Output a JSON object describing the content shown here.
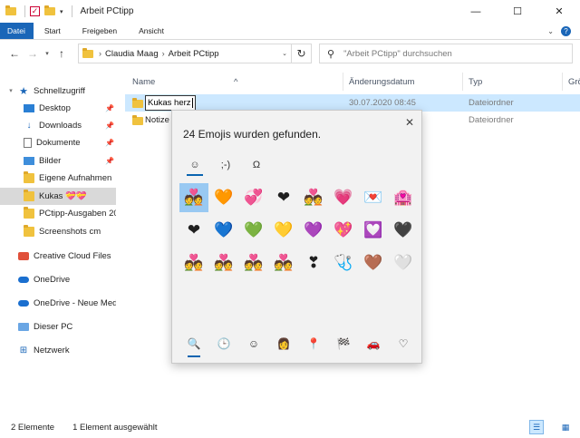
{
  "window": {
    "title": "Arbeit PCtipp",
    "minimize": "—",
    "maximize": "☐",
    "close": "✕"
  },
  "ribbon": {
    "tabs": [
      "Datei",
      "Start",
      "Freigeben",
      "Ansicht"
    ],
    "help": "?"
  },
  "address": {
    "crumbs": [
      "Claudia Maag",
      "Arbeit PCtipp"
    ],
    "search_placeholder": "\"Arbeit PCtipp\" durchsuchen"
  },
  "sidebar": {
    "items": [
      {
        "label": "Schnellzugriff",
        "icon": "star-icon"
      },
      {
        "label": "Desktop",
        "icon": "desktop-icon"
      },
      {
        "label": "Downloads",
        "icon": "download-icon"
      },
      {
        "label": "Dokumente",
        "icon": "document-icon"
      },
      {
        "label": "Bilder",
        "icon": "pictures-icon"
      },
      {
        "label": "Eigene Aufnahmen",
        "icon": "folder-icon"
      },
      {
        "label": "Kukas 💝💝",
        "icon": "folder-icon"
      },
      {
        "label": "PCtipp-Ausgaben 20",
        "icon": "folder-icon"
      },
      {
        "label": "Screenshots cm",
        "icon": "folder-icon"
      },
      {
        "label": "Creative Cloud Files",
        "icon": "creative-cloud-icon"
      },
      {
        "label": "OneDrive",
        "icon": "onedrive-icon"
      },
      {
        "label": "OneDrive - Neue Med",
        "icon": "onedrive-icon"
      },
      {
        "label": "Dieser PC",
        "icon": "computer-icon"
      },
      {
        "label": "Netzwerk",
        "icon": "network-icon"
      }
    ]
  },
  "columns": {
    "name": "Name",
    "date": "Änderungsdatum",
    "type": "Typ",
    "size": "Grö"
  },
  "files": [
    {
      "name": "Kukas herz",
      "date": "30.07.2020 08:45",
      "type": "Dateiordner"
    },
    {
      "name": "Notize",
      "date": "",
      "type": "Dateiordner"
    }
  ],
  "status": {
    "count": "2 Elemente",
    "selected": "1 Element ausgewählt"
  },
  "emoji_panel": {
    "title": "24 Emojis wurden gefunden.",
    "tabs": [
      "☺",
      ";-)",
      "Ω"
    ],
    "emojis": [
      "💑",
      "🧡",
      "💞",
      "❤",
      "💑",
      "💗",
      "💌",
      "🏩",
      "❤",
      "💙",
      "💚",
      "💛",
      "💜",
      "💖",
      "💟",
      "🖤",
      "💑",
      "💑",
      "💑",
      "💑",
      "❣",
      "🩺",
      "🤎",
      "🤍"
    ],
    "categories": [
      "🔍",
      "🕒",
      "☺",
      "👩",
      "📍",
      "🏁",
      "🚗",
      "♡"
    ],
    "close": "✕"
  }
}
